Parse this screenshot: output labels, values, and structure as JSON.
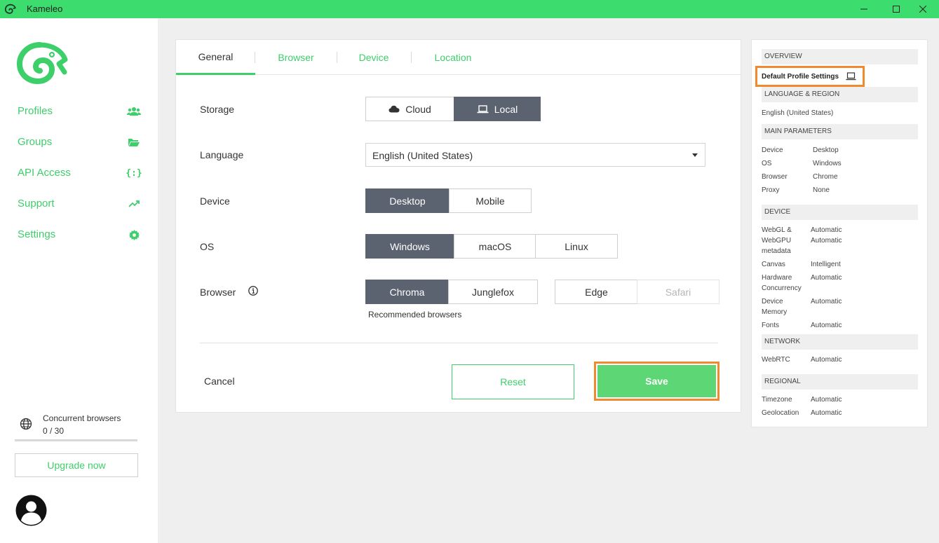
{
  "window": {
    "title": "Kameleo",
    "accent": "#3ddc6e"
  },
  "sidebar": {
    "items": [
      {
        "label": "Profiles",
        "icon": "users-icon"
      },
      {
        "label": "Groups",
        "icon": "folder-open-icon"
      },
      {
        "label": "API Access",
        "icon": "code-braces-icon"
      },
      {
        "label": "Support",
        "icon": "trend-up-icon"
      },
      {
        "label": "Settings",
        "icon": "gear-icon"
      }
    ],
    "concurrent_label": "Concurrent browsers",
    "concurrent_value": "0 / 30",
    "upgrade_label": "Upgrade now"
  },
  "tabs": [
    "General",
    "Browser",
    "Device",
    "Location"
  ],
  "form": {
    "storage": {
      "label": "Storage",
      "options": [
        "Cloud",
        "Local"
      ],
      "selected": "Local"
    },
    "language": {
      "label": "Language",
      "value": "English (United States)"
    },
    "device": {
      "label": "Device",
      "options": [
        "Desktop",
        "Mobile"
      ],
      "selected": "Desktop"
    },
    "os": {
      "label": "OS",
      "options": [
        "Windows",
        "macOS",
        "Linux"
      ],
      "selected": "Windows"
    },
    "browser": {
      "label": "Browser",
      "recommended": [
        "Chroma",
        "Junglefox"
      ],
      "others": [
        "Edge",
        "Safari"
      ],
      "selected": "Chroma",
      "recommended_label": "Recommended browsers"
    },
    "cancel_label": "Cancel",
    "reset_label": "Reset",
    "save_label": "Save"
  },
  "overview": {
    "title": "OVERVIEW",
    "profile_name": "Default Profile Settings",
    "lang_title": "LANGUAGE & REGION",
    "lang_value": "English (United States)",
    "main_title": "MAIN PARAMETERS",
    "main": [
      {
        "k": "Device",
        "v": "Desktop"
      },
      {
        "k": "OS",
        "v": "Windows"
      },
      {
        "k": "Browser",
        "v": "Chrome"
      },
      {
        "k": "Proxy",
        "v": "None"
      }
    ],
    "device_title": "DEVICE",
    "device": {
      "webgl_k1": "WebGL &",
      "webgl_k2": "WebGPU",
      "webgl_k3": "metadata",
      "webgl_v1": "Automatic",
      "webgl_v2": "Automatic",
      "canvas_k": "Canvas",
      "canvas_v": "Intelligent",
      "hw_k1": "Hardware",
      "hw_k2": "Concurrency",
      "hw_v": "Automatic",
      "mem_k1": "Device",
      "mem_k2": "Memory",
      "mem_v": "Automatic",
      "fonts_k": "Fonts",
      "fonts_v": "Automatic"
    },
    "network_title": "NETWORK",
    "network": {
      "k": "WebRTC",
      "v": "Automatic"
    },
    "regional_title": "REGIONAL",
    "regional": [
      {
        "k": "Timezone",
        "v": "Automatic"
      },
      {
        "k": "Geolocation",
        "v": "Automatic"
      }
    ]
  }
}
